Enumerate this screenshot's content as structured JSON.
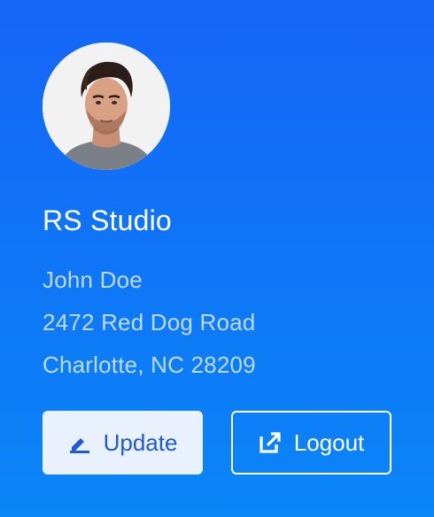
{
  "profile": {
    "company": "RS Studio",
    "name": "John Doe",
    "street": "2472 Red Dog Road",
    "city_line": "Charlotte, NC 28209",
    "avatar_icon": "person-portrait"
  },
  "actions": {
    "update_label": "Update",
    "update_icon": "edit-pen-icon",
    "logout_label": "Logout",
    "logout_icon": "external-link-icon"
  },
  "colors": {
    "gradient_top": "#1565f7",
    "gradient_bottom": "#0a86f7",
    "update_bg": "#e9f1fd",
    "update_text": "#1e5bd6",
    "logout_border": "#ffffff"
  }
}
